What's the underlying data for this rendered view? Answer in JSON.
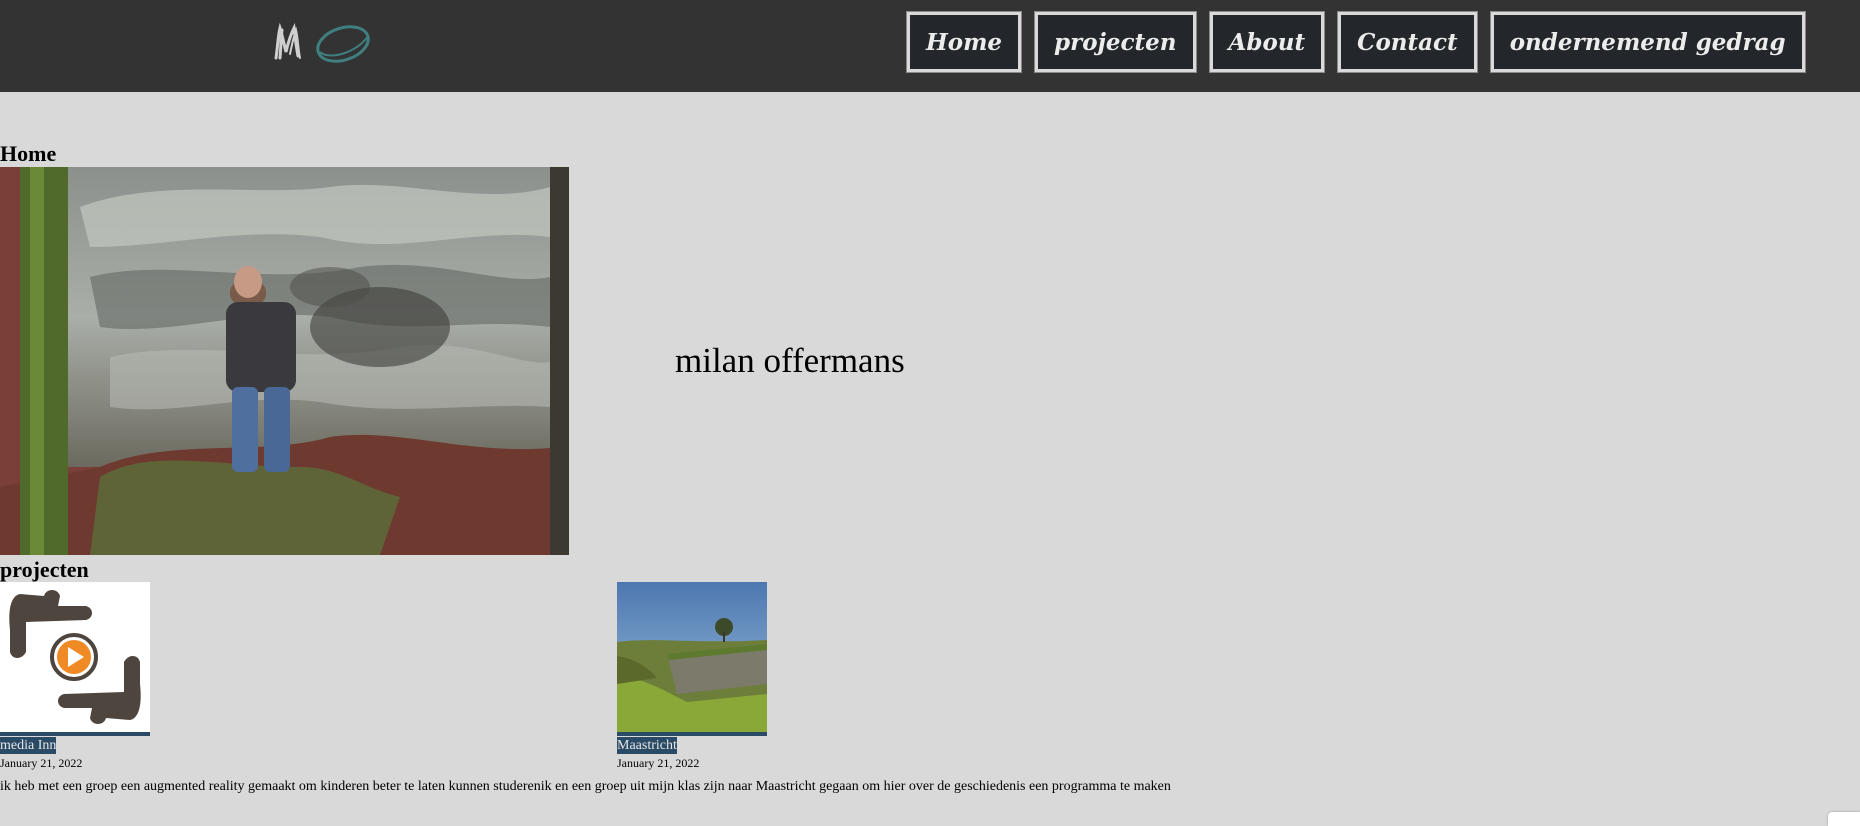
{
  "site": {
    "logo_alt": "Mo logo",
    "logo_text": "Mo"
  },
  "nav": {
    "items": [
      {
        "label": "Home"
      },
      {
        "label": "projecten"
      },
      {
        "label": "About"
      },
      {
        "label": "Contact"
      },
      {
        "label": "ondernemend gedrag"
      }
    ]
  },
  "home": {
    "heading": "Home",
    "name": "milan offermans",
    "photo_icon": "portrait-photo"
  },
  "projects": {
    "heading": "projecten",
    "cards": [
      {
        "title": "media Inn",
        "date": "January 21, 2022",
        "thumb_icon": "hands-play-icon"
      },
      {
        "title": "Maastricht",
        "date": "January 21, 2022",
        "thumb_icon": "fortress-photo"
      }
    ],
    "description": "ik heb met een groep een augmented reality gemaakt om kinderen beter te laten kunnen studerenik en een groep uit mijn klas zijn naar Maastricht gegaan om hier over de geschiedenis een programma te maken"
  },
  "colors": {
    "header_bg": "#333333",
    "page_bg": "#d9d9d9",
    "nav_btn_bg": "#23262b",
    "card_label_bg": "#2a4a66",
    "logo_accent": "#3f7f80"
  }
}
